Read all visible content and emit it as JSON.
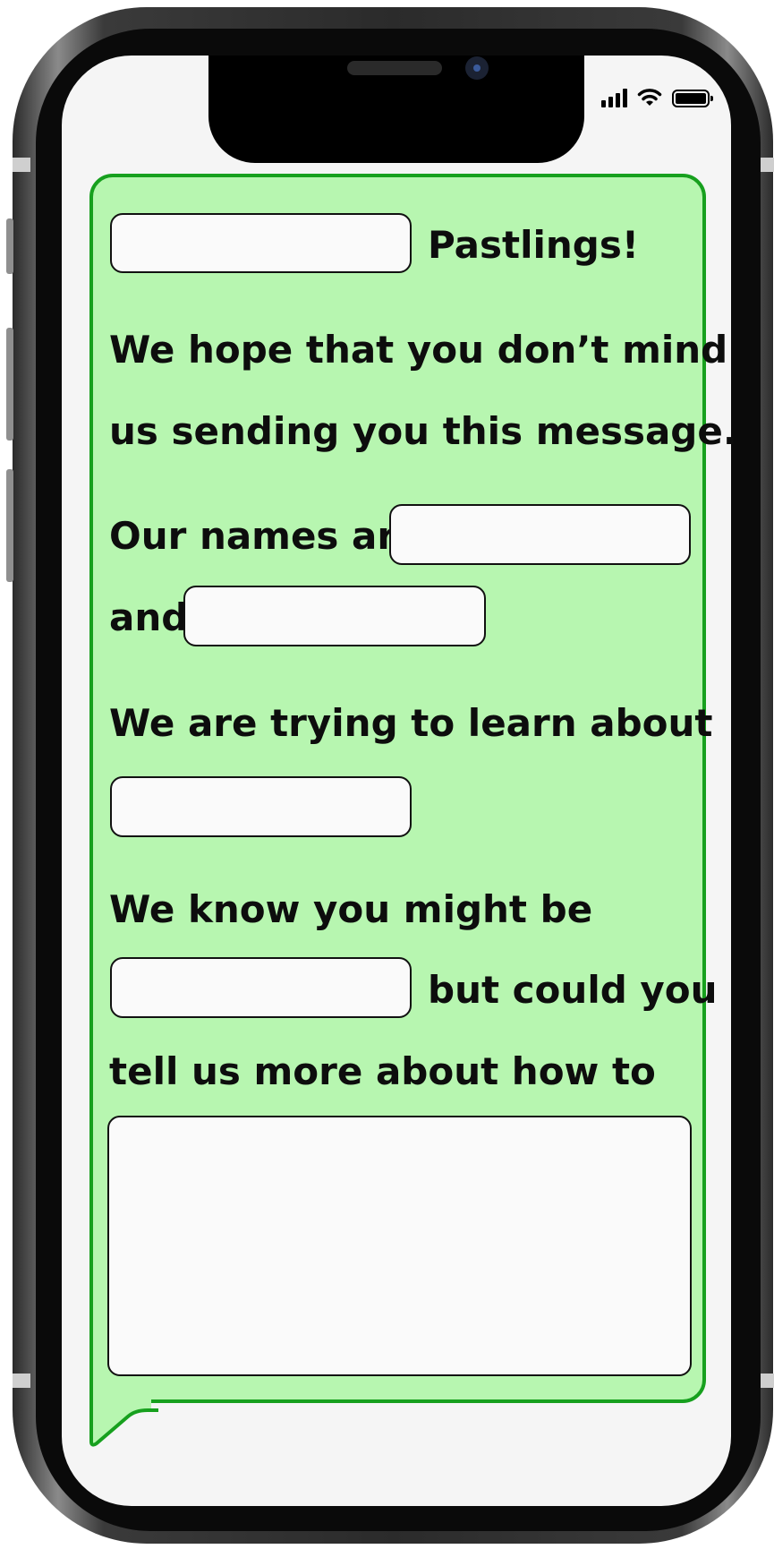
{
  "message": {
    "greeting_suffix": "Pastlings!",
    "line_hope_1": "We hope that you don’t mind",
    "line_hope_2": "us sending you this message.",
    "names_prefix": "Our names are",
    "names_and": "and",
    "learn_line": "We are trying to learn about",
    "know_line": "We know you might be",
    "could_you": "but could you",
    "tell_us_line": "tell us more about how to"
  },
  "fields": {
    "greeting": "",
    "name_1": "",
    "name_2": "",
    "topic": "",
    "descriptor": "",
    "request": ""
  },
  "colors": {
    "bubble_fill": "#b7f6b0",
    "bubble_border": "#17a01e",
    "screen_bg": "#f5f5f5"
  },
  "icons": [
    "signal-icon",
    "wifi-icon",
    "battery-icon"
  ]
}
